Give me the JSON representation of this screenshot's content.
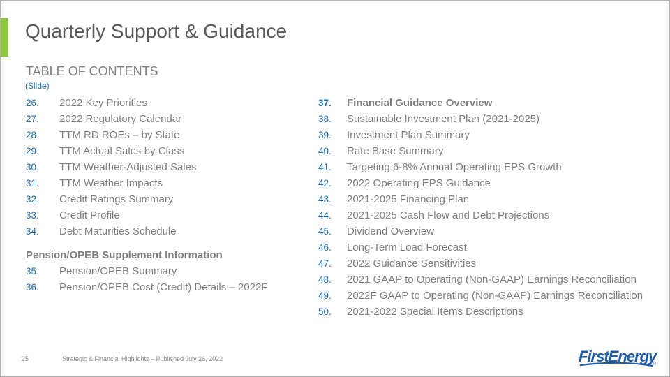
{
  "title": "Quarterly Support & Guidance",
  "toc": {
    "heading": "TABLE OF CONTENTS",
    "subheading": "(Slide)",
    "left_items": [
      {
        "num": "26.",
        "label": "2022 Key Priorities"
      },
      {
        "num": "27.",
        "label": "2022 Regulatory Calendar"
      },
      {
        "num": "28.",
        "label": "TTM RD ROEs – by State"
      },
      {
        "num": "29.",
        "label": "TTM Actual Sales by Class"
      },
      {
        "num": "30.",
        "label": "TTM Weather-Adjusted Sales"
      },
      {
        "num": "31.",
        "label": "TTM Weather Impacts"
      },
      {
        "num": "32.",
        "label": "Credit Ratings Summary"
      },
      {
        "num": "33.",
        "label": "Credit Profile"
      },
      {
        "num": "34.",
        "label": "Debt Maturities Schedule"
      }
    ],
    "pension_section": {
      "heading": "Pension/OPEB Supplement Information",
      "items": [
        {
          "num": "35.",
          "label": "Pension/OPEB Summary"
        },
        {
          "num": "36.",
          "label": "Pension/OPEB Cost (Credit) Details – 2022F"
        }
      ]
    },
    "right_items": [
      {
        "num": "37.",
        "label": "Financial Guidance Overview",
        "bold": true
      },
      {
        "num": "38.",
        "label": "Sustainable Investment Plan (2021-2025)"
      },
      {
        "num": "39.",
        "label": "Investment Plan Summary"
      },
      {
        "num": "40.",
        "label": "Rate Base Summary"
      },
      {
        "num": "41.",
        "label": "Targeting 6-8% Annual Operating EPS Growth"
      },
      {
        "num": "42.",
        "label": "2022 Operating EPS Guidance"
      },
      {
        "num": "43.",
        "label": "2021-2025 Financing Plan"
      },
      {
        "num": "44.",
        "label": "2021-2025 Cash Flow and Debt Projections"
      },
      {
        "num": "45.",
        "label": "Dividend Overview"
      },
      {
        "num": "46.",
        "label": "Long-Term Load Forecast"
      },
      {
        "num": "47.",
        "label": "2022 Guidance Sensitivities"
      },
      {
        "num": "48.",
        "label": "2021 GAAP to Operating (Non-GAAP) Earnings Reconciliation"
      },
      {
        "num": "49.",
        "label": "2022F GAAP to Operating (Non-GAAP) Earnings Reconciliation"
      },
      {
        "num": "50.",
        "label": "2021-2022 Special Items Descriptions"
      }
    ]
  },
  "footer": {
    "page_number": "25",
    "text": "Strategic & Financial Highlights – Published July 26, 2022"
  },
  "logo": {
    "text": "FirstEnergy",
    "registered": "®"
  },
  "colors": {
    "accent": "#8dc63f",
    "link_blue": "#1f6fb5",
    "brand_blue": "#1d5aa8",
    "text_gray": "#808080"
  }
}
